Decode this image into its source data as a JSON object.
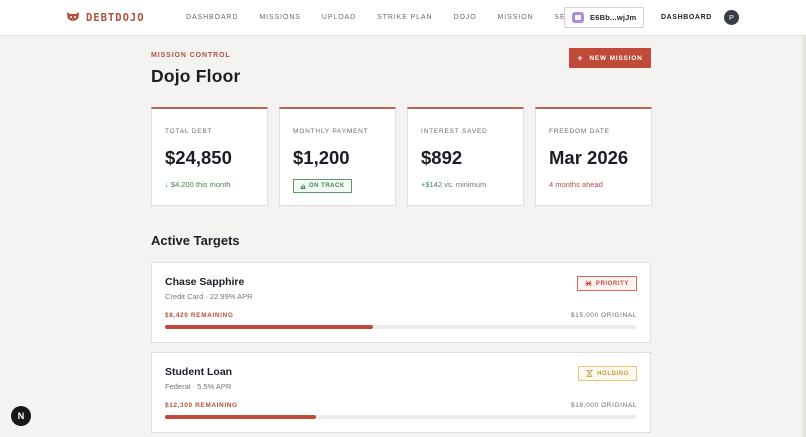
{
  "nav": {
    "brand": "DEBTDOJO",
    "links": [
      "DASHBOARD",
      "MISSIONS",
      "UPLOAD",
      "STRIKE PLAN",
      "DOJO",
      "MISSION",
      "SENSEI"
    ],
    "wallet": "E6Bb...wjJm",
    "dashboard": "DASHBOARD",
    "avatar_initial": "P"
  },
  "header": {
    "eyebrow": "MISSION CONTROL",
    "title": "Dojo Floor",
    "new_mission": "NEW MISSION"
  },
  "stats": [
    {
      "label": "TOTAL DEBT",
      "value": "$24,850",
      "sub": "↓ $4,200 this month"
    },
    {
      "label": "MONTHLY PAYMENT",
      "value": "$1,200",
      "badge": "ON TRACK"
    },
    {
      "label": "INTEREST SAVED",
      "value": "$892",
      "sub_strong": "+$142",
      "sub": " vs. minimum"
    },
    {
      "label": "FREEDOM DATE",
      "value": "Mar 2026",
      "sub": "4 months ahead"
    }
  ],
  "targets_section": {
    "title": "Active Targets"
  },
  "targets": [
    {
      "name": "Chase Sapphire",
      "sub": "Credit Card · 22.99% APR",
      "badge": "PRIORITY",
      "remaining": "$8,420 REMAINING",
      "original": "$15,000 ORIGINAL",
      "progress": 0.44
    },
    {
      "name": "Student Loan",
      "sub": "Federal · 5.5% APR",
      "badge": "HOLDING",
      "remaining": "$12,300 REMAINING",
      "original": "$18,000 ORIGINAL",
      "progress": 0.32
    }
  ],
  "colors": {
    "accent": "#bf4a37",
    "positive": "#3f8a4c",
    "holding": "#c9983c"
  },
  "dev_badge": "N"
}
